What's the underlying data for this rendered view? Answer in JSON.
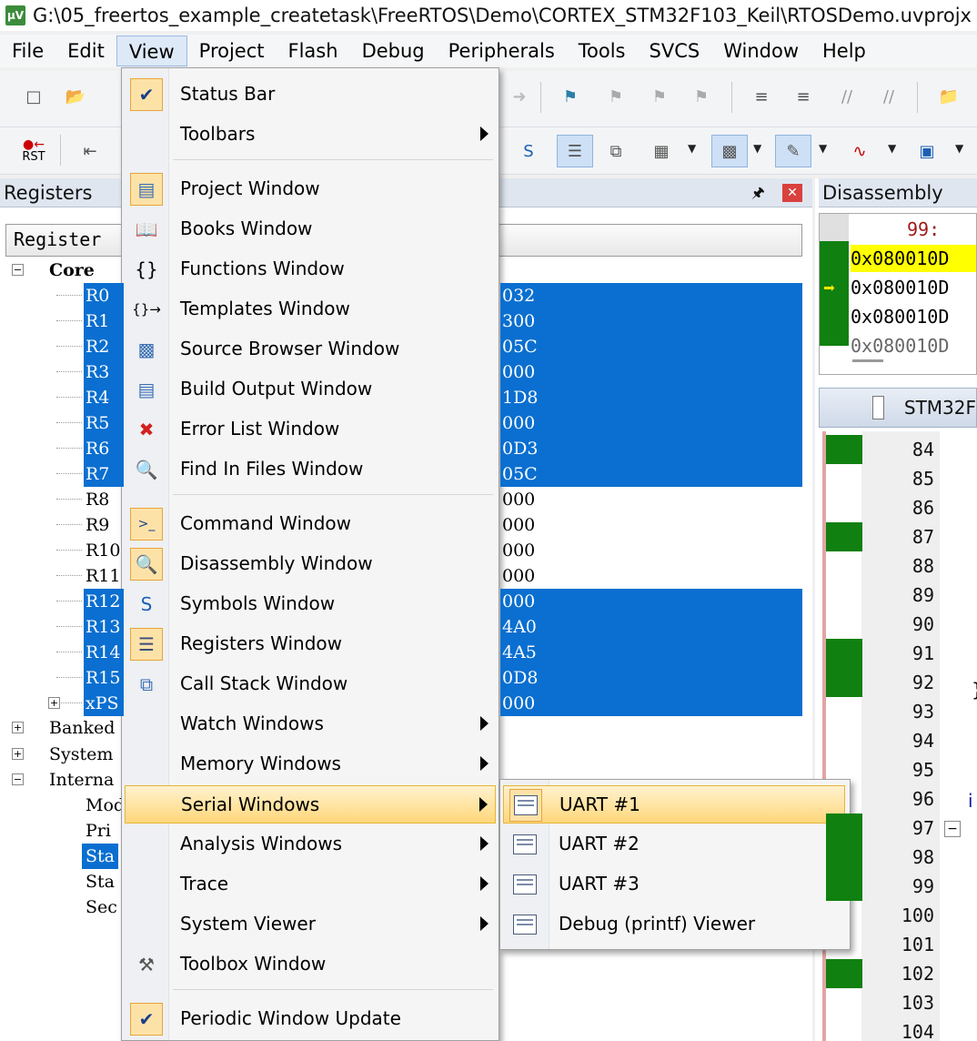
{
  "window": {
    "title": "G:\\05_freertos_example_createtask\\FreeRTOS\\Demo\\CORTEX_STM32F103_Keil\\RTOSDemo.uvprojx",
    "app_icon": "µV"
  },
  "menubar": {
    "items": [
      "File",
      "Edit",
      "View",
      "Project",
      "Flash",
      "Debug",
      "Peripherals",
      "Tools",
      "SVCS",
      "Window",
      "Help"
    ],
    "active": "View"
  },
  "toolbar": {
    "rst_label": "RST"
  },
  "registers_pane": {
    "title": "Registers",
    "column_header": "Register",
    "core_label": "Core",
    "rows": [
      {
        "name": "R0",
        "value": "032",
        "selected": true
      },
      {
        "name": "R1",
        "value": "300",
        "selected": true
      },
      {
        "name": "R2",
        "value": "05C",
        "selected": true
      },
      {
        "name": "R3",
        "value": "000",
        "selected": true
      },
      {
        "name": "R4",
        "value": "1D8",
        "selected": true
      },
      {
        "name": "R5",
        "value": "000",
        "selected": true
      },
      {
        "name": "R6",
        "value": "0D3",
        "selected": true
      },
      {
        "name": "R7",
        "value": "05C",
        "selected": true
      },
      {
        "name": "R8",
        "value": "000",
        "selected": false
      },
      {
        "name": "R9",
        "value": "000",
        "selected": false
      },
      {
        "name": "R10",
        "value": "000",
        "selected": false
      },
      {
        "name": "R11",
        "value": "000",
        "selected": false
      },
      {
        "name": "R12",
        "value": "000",
        "selected": true
      },
      {
        "name": "R13",
        "value": "4A0",
        "selected": true
      },
      {
        "name": "R14",
        "value": "4A5",
        "selected": true
      },
      {
        "name": "R15",
        "value": "0D8",
        "selected": true
      },
      {
        "name": "xPS",
        "value": "000",
        "selected": true
      }
    ],
    "groups": [
      "Banked",
      "System",
      "Interna"
    ],
    "internal_children": [
      "Mod",
      "Pri",
      "Sta",
      "Sta",
      "Sec"
    ]
  },
  "disassembly_pane": {
    "title": "Disassembly",
    "line_number": "99:",
    "addresses": [
      "0x080010D",
      "0x080010D",
      "0x080010D",
      "0x080010D"
    ]
  },
  "source_tab": {
    "label": "STM32F"
  },
  "source_lines": [
    "84",
    "85",
    "86",
    "87",
    "88",
    "89",
    "90",
    "91",
    "92",
    "93",
    "94",
    "95",
    "96",
    "97",
    "98",
    "99",
    "100",
    "101",
    "102",
    "103",
    "104"
  ],
  "view_menu": {
    "items": [
      {
        "label": "Status Bar",
        "icon": "check-icon"
      },
      {
        "label": "Toolbars",
        "icon": "none"
      },
      {
        "label": "Project Window",
        "icon": "project-window-icon"
      },
      {
        "label": "Books Window",
        "icon": "books-icon"
      },
      {
        "label": "Functions Window",
        "icon": "braces-icon"
      },
      {
        "label": "Templates Window",
        "icon": "templates-icon"
      },
      {
        "label": "Source Browser Window",
        "icon": "source-browser-icon"
      },
      {
        "label": "Build Output Window",
        "icon": "build-output-icon"
      },
      {
        "label": "Error List Window",
        "icon": "error-x-icon"
      },
      {
        "label": "Find In Files Window",
        "icon": "find-in-files-icon"
      },
      {
        "label": "Command Window",
        "icon": "command-icon"
      },
      {
        "label": "Disassembly Window",
        "icon": "disassembly-icon"
      },
      {
        "label": "Symbols Window",
        "icon": "symbols-icon"
      },
      {
        "label": "Registers Window",
        "icon": "registers-icon"
      },
      {
        "label": "Call Stack Window",
        "icon": "call-stack-icon"
      },
      {
        "label": "Watch Windows",
        "icon": "none"
      },
      {
        "label": "Memory Windows",
        "icon": "none"
      },
      {
        "label": "Serial Windows",
        "icon": "none"
      },
      {
        "label": "Analysis Windows",
        "icon": "none"
      },
      {
        "label": "Trace",
        "icon": "none"
      },
      {
        "label": "System Viewer",
        "icon": "none"
      },
      {
        "label": "Toolbox Window",
        "icon": "toolbox-icon"
      },
      {
        "label": "Periodic Window Update",
        "icon": "check-icon"
      }
    ],
    "highlighted": "Serial Windows"
  },
  "serial_menu": {
    "items": [
      "UART #1",
      "UART #2",
      "UART #3",
      "Debug (printf) Viewer"
    ],
    "highlighted": "UART #1"
  },
  "colors": {
    "selection_blue": "#0a6fd0",
    "menu_highlight": "#ffd77a",
    "exec_green": "#108010",
    "current_line_yellow": "#ffff00"
  }
}
